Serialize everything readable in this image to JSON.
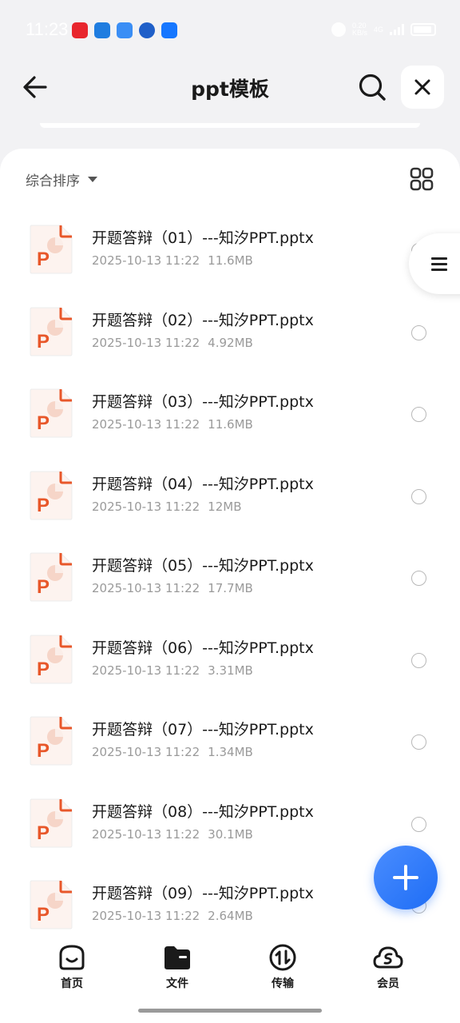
{
  "status_bar": {
    "time": "11:23",
    "app_icons": [
      {
        "name": "red-app-icon",
        "color": "#e8262d"
      },
      {
        "name": "blue-app-icon",
        "color": "#1f7de0"
      },
      {
        "name": "lightblue-app-icon",
        "color": "#3a8ef5"
      },
      {
        "name": "blue-round-app-icon",
        "color": "#1f5fc8"
      },
      {
        "name": "alipay-icon",
        "color": "#1677ff"
      }
    ],
    "net_speed_line1": "0.20",
    "net_speed_line2": "KB/s",
    "signal_label": "4G"
  },
  "header": {
    "title": "ppt模板"
  },
  "sort": {
    "label": "综合排序"
  },
  "files": [
    {
      "name": "开题答辩（01）---知汐PPT.pptx",
      "date": "2025-10-13 11:22",
      "size": "11.6MB"
    },
    {
      "name": "开题答辩（02）---知汐PPT.pptx",
      "date": "2025-10-13 11:22",
      "size": "4.92MB"
    },
    {
      "name": "开题答辩（03）---知汐PPT.pptx",
      "date": "2025-10-13 11:22",
      "size": "11.6MB"
    },
    {
      "name": "开题答辩（04）---知汐PPT.pptx",
      "date": "2025-10-13 11:22",
      "size": "12MB"
    },
    {
      "name": "开题答辩（05）---知汐PPT.pptx",
      "date": "2025-10-13 11:22",
      "size": "17.7MB"
    },
    {
      "name": "开题答辩（06）---知汐PPT.pptx",
      "date": "2025-10-13 11:22",
      "size": "3.31MB"
    },
    {
      "name": "开题答辩（07）---知汐PPT.pptx",
      "date": "2025-10-13 11:22",
      "size": "1.34MB"
    },
    {
      "name": "开题答辩（08）---知汐PPT.pptx",
      "date": "2025-10-13 11:22",
      "size": "30.1MB"
    },
    {
      "name": "开题答辩（09）---知汐PPT.pptx",
      "date": "2025-10-13 11:22",
      "size": "2.64MB"
    }
  ],
  "file_icon": {
    "letter": "P",
    "accent": "#e8572a",
    "bg": "#fdf3ef"
  },
  "bottom_nav": [
    {
      "label": "首页",
      "icon": "home-smile-icon"
    },
    {
      "label": "文件",
      "icon": "folder-icon"
    },
    {
      "label": "传输",
      "icon": "transfer-icon"
    },
    {
      "label": "会员",
      "icon": "vip-cloud-icon"
    }
  ],
  "colors": {
    "accent_blue": "#1e6df5",
    "ppt_orange": "#e8572a"
  }
}
